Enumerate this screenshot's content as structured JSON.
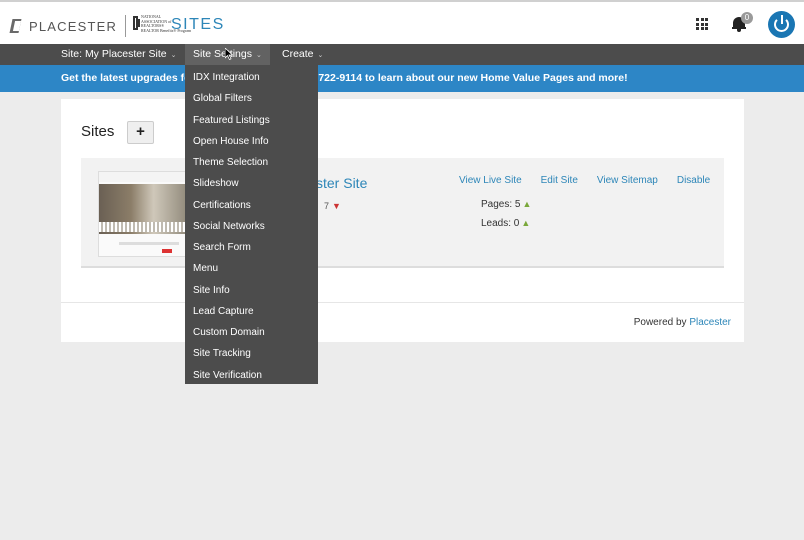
{
  "header": {
    "brand": "PLACESTER",
    "partner_lines": [
      "NATIONAL",
      "ASSOCIATION of",
      "REALTORS®",
      "REALTOR Benefits® Program"
    ],
    "product": "SITES",
    "notification_count": "0",
    "icons": [
      "apps-grid-icon",
      "bell-icon",
      "power-icon"
    ],
    "accent": "#2d86b8"
  },
  "nav": {
    "site_label": "Site: ",
    "site_value": "My Placester Site",
    "settings": "Site Settings",
    "create": "Create",
    "chevron": "⌄"
  },
  "banner": {
    "text": "Get the latest upgrades for your site! Call us at 800-722-9114 to learn about our new Home Value Pages and more!",
    "color": "#2d86c6"
  },
  "main": {
    "title": "Sites",
    "add_label": "+",
    "site": {
      "name": "My Placester Site",
      "visible_name": "ster Site",
      "trend_digit": "7",
      "trend_icon": "▼",
      "actions": [
        "View Live Site",
        "Edit Site",
        "View Sitemap",
        "Disable"
      ],
      "pages": "Pages: 5",
      "leads": "Leads: 0",
      "up_icon": "▲"
    },
    "footer_prefix": "Powered by ",
    "footer_link": "Placester"
  },
  "dropdown": {
    "items": [
      "IDX Integration",
      "Global Filters",
      "Featured Listings",
      "Open House Info",
      "Theme Selection",
      "Slideshow",
      "Certifications",
      "Social Networks",
      "Search Form",
      "Menu",
      "Site Info",
      "Lead Capture",
      "Custom Domain",
      "Site Tracking",
      "Site Verification"
    ]
  }
}
